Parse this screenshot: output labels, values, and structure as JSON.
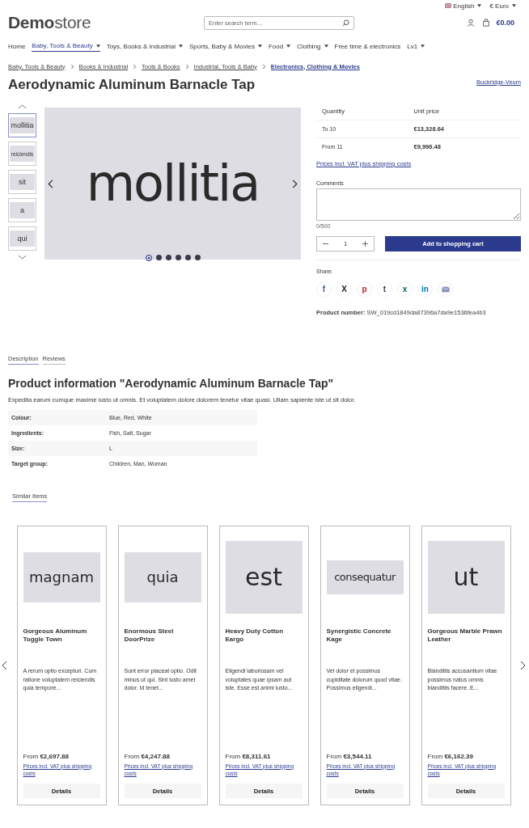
{
  "top_bar": {
    "language": "English",
    "currency": "€ Euro"
  },
  "header": {
    "logo_bold": "Demo",
    "logo_light": "store",
    "search": {
      "placeholder": "Enter search term..."
    },
    "cart_total": "€0.00"
  },
  "nav": [
    {
      "label": "Home",
      "dropdown": false,
      "selected": false
    },
    {
      "label": "Baby, Tools & Beauty",
      "dropdown": true,
      "selected": true
    },
    {
      "label": "Toys, Books & Industrial",
      "dropdown": true,
      "selected": false
    },
    {
      "label": "Sports, Baby & Movies",
      "dropdown": true,
      "selected": false
    },
    {
      "label": "Food",
      "dropdown": true,
      "selected": false
    },
    {
      "label": "Clothing",
      "dropdown": true,
      "selected": false
    },
    {
      "label": "Free time & electronics",
      "dropdown": false,
      "selected": false
    },
    {
      "label": "Lv1",
      "dropdown": true,
      "selected": false
    }
  ],
  "breadcrumb": [
    {
      "label": "Baby, Tools & Beauty",
      "selected": false
    },
    {
      "label": "Books & Industrial",
      "selected": false
    },
    {
      "label": "Tools & Books",
      "selected": false
    },
    {
      "label": "Industrial, Tools & Baby",
      "selected": false
    },
    {
      "label": "Electronics, Clothing & Movies",
      "selected": true
    }
  ],
  "product": {
    "title": "Aerodynamic Aluminum Barnacle Tap",
    "manufacturer": "Buckridge-Veum",
    "thumbnails": [
      {
        "image_text": "mollitia",
        "selected": true
      },
      {
        "image_text": "reiciendis",
        "selected": false
      },
      {
        "image_text": "sit",
        "selected": false
      },
      {
        "image_text": "a",
        "selected": false
      },
      {
        "image_text": "qui",
        "selected": false
      }
    ],
    "main_image_text": "mollitia",
    "dots": [
      {
        "selected": true
      },
      {
        "selected": false
      },
      {
        "selected": false
      },
      {
        "selected": false
      },
      {
        "selected": false
      },
      {
        "selected": false
      }
    ],
    "price_table": {
      "columns": [
        "Quantity",
        "Unit price"
      ],
      "rows": [
        [
          "To 10",
          "€13,328.64"
        ],
        [
          "From 11",
          "€9,996.48"
        ]
      ]
    },
    "tax_link": "Prices incl. VAT plus shipping costs",
    "comments": {
      "label": "Comments",
      "counter": "0/500"
    },
    "quantity": "1",
    "add_to_cart": "Add to shopping cart",
    "share_label": "Share:",
    "share": [
      {
        "kind": "letter",
        "glyph": "f",
        "color": "#3b5998"
      },
      {
        "kind": "letter",
        "glyph": "X",
        "color": "#222222"
      },
      {
        "kind": "letter",
        "glyph": "p",
        "color": "#cb2027"
      },
      {
        "kind": "letter",
        "glyph": "t",
        "color": "#35465c"
      },
      {
        "kind": "letter",
        "glyph": "x",
        "color": "#026466"
      },
      {
        "kind": "letter",
        "glyph": "in",
        "color": "#0077b5"
      },
      {
        "kind": "mail",
        "color": "#8a8fb8"
      }
    ],
    "product_number_label": "Product number:",
    "product_number": "SW_019cd1849da87396a7da9e1536fea4b3"
  },
  "tabs": [
    {
      "label": "Description",
      "selected": true
    },
    {
      "label": "Reviews",
      "selected": false
    }
  ],
  "description": {
    "heading": "Product information \"Aerodynamic Aluminum Barnacle Tap\"",
    "text": "Expedita earum cumque maxime iusto ut omnis. Et voluptatem dolore dolorem tenetur vitae quasi. Ullam sapiente iste ut sit dolor.",
    "properties": [
      [
        "Colour:",
        "Blue, Red, White"
      ],
      [
        "Ingredients:",
        "Fish, Salt, Sugar"
      ],
      [
        "Size:",
        "L"
      ],
      [
        "Target group:",
        "Children, Man, Woman"
      ]
    ]
  },
  "similar": {
    "tab": "Similar Items",
    "items": [
      {
        "image_text": "magnam",
        "name": "Gorgeous Aluminum Toggle Town",
        "text": "A rerum optio excepturi. Cum ratione voluptatem reiciendis quia tempore...",
        "from": "From",
        "price": "€2,697.88",
        "tax_link": "Prices incl. VAT plus shipping costs",
        "button": "Details"
      },
      {
        "image_text": "quia",
        "name": "Enormous Steel DoorPrize",
        "text": "Sunt error placeat optio. Odit minus ut qui. Sint iusto amet dolor. Id tenet...",
        "from": "From",
        "price": "€4,247.88",
        "tax_link": "Prices incl. VAT plus shipping costs",
        "button": "Details"
      },
      {
        "image_text": "est",
        "name": "Heavy Duty Cotton Eargo",
        "text": "Eligendi laboriosam vel voluptates quae ipsam aut iste. Esse est animi iusto...",
        "from": "From",
        "price": "€8,311.61",
        "tax_link": "Prices incl. VAT plus shipping costs",
        "button": "Details"
      },
      {
        "image_text": "consequatur",
        "name": "Synergistic Concrete Kage",
        "text": "Vel dolor et possimus cupiditate dolorum quod vitae. Possimus eligendi...",
        "from": "From",
        "price": "€3,544.11",
        "tax_link": "Prices incl. VAT plus shipping costs",
        "button": "Details"
      },
      {
        "image_text": "ut",
        "name": "Gorgeous Marble Prawn Leather",
        "text": "Blanditiis accusantium vitae possimus natus omnis blanditiis facere. E...",
        "from": "From",
        "price": "€6,162.39",
        "tax_link": "Prices incl. VAT plus shipping costs",
        "button": "Details"
      }
    ]
  }
}
